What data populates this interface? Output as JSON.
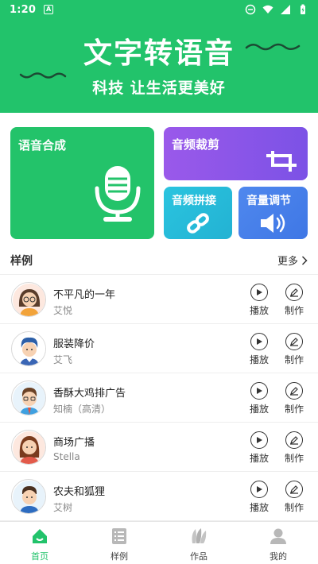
{
  "status_bar": {
    "time": "1:20",
    "notification_glyph": "A"
  },
  "header": {
    "title": "文字转语音",
    "subtitle": "科技  让生活更美好",
    "bg_color": "#22c36b"
  },
  "cards": {
    "synth": {
      "label": "语音合成",
      "icon": "microphone-icon"
    },
    "crop": {
      "label": "音频裁剪",
      "icon": "crop-icon"
    },
    "splice": {
      "label": "音频拼接",
      "icon": "link-icon"
    },
    "volume": {
      "label": "音量调节",
      "icon": "speaker-icon"
    }
  },
  "samples": {
    "title": "样例",
    "more_label": "更多",
    "play_label": "播放",
    "make_label": "制作",
    "items": [
      {
        "title": "不平凡的一年",
        "voice": "艾悦"
      },
      {
        "title": "服装降价",
        "voice": "艾飞"
      },
      {
        "title": "香酥大鸡排广告",
        "voice": "知楠（高清）"
      },
      {
        "title": "商场广播",
        "voice": "Stella"
      },
      {
        "title": "农夫和狐狸",
        "voice": "艾树"
      }
    ]
  },
  "bottom_nav": {
    "active_color": "#22c36b",
    "tabs": [
      {
        "label": "首页",
        "icon": "home-icon"
      },
      {
        "label": "样例",
        "icon": "list-icon"
      },
      {
        "label": "作品",
        "icon": "works-icon"
      },
      {
        "label": "我的",
        "icon": "profile-icon"
      }
    ]
  }
}
